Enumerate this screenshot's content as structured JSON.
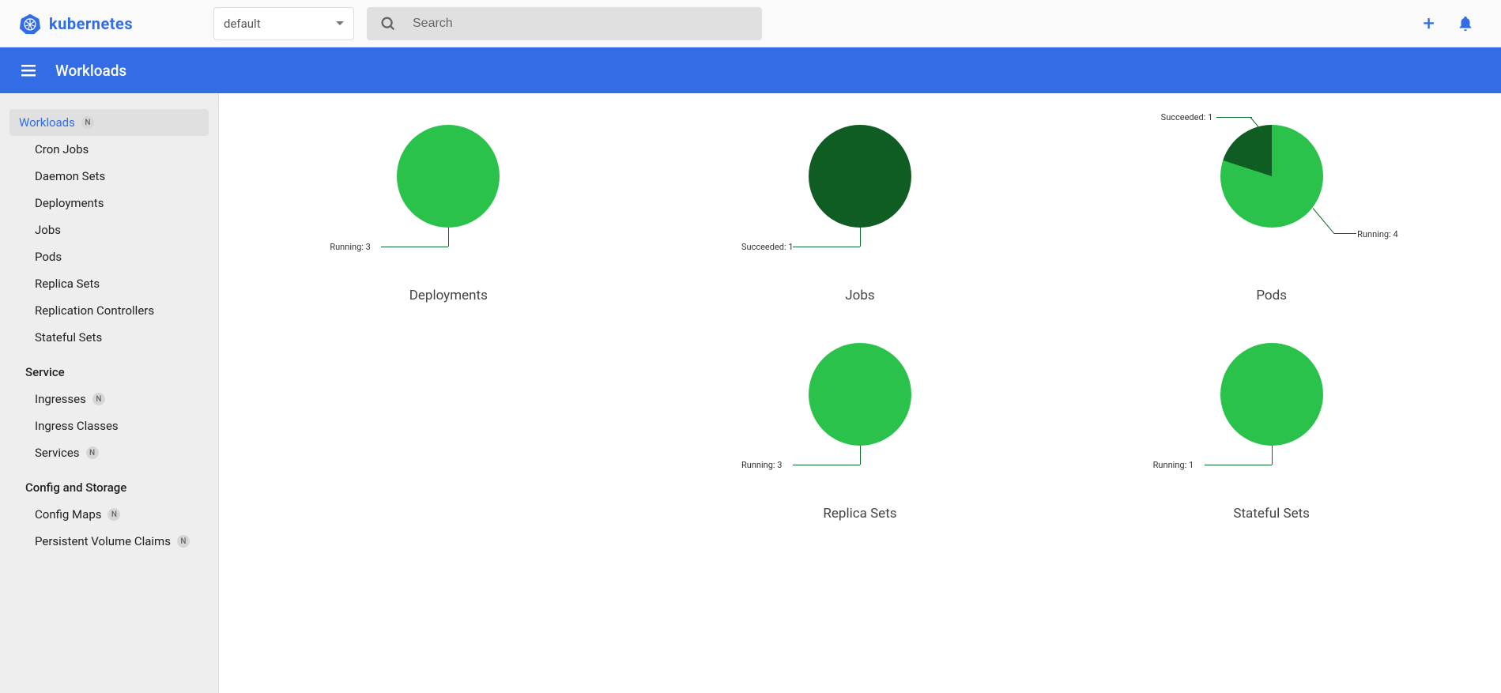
{
  "header": {
    "brand": "kubernetes",
    "namespace_selected": "default",
    "search_placeholder": "Search"
  },
  "subheader": {
    "title": "Workloads"
  },
  "sidebar": {
    "workloads_label": "Workloads",
    "items_workloads": [
      "Cron Jobs",
      "Daemon Sets",
      "Deployments",
      "Jobs",
      "Pods",
      "Replica Sets",
      "Replication Controllers",
      "Stateful Sets"
    ],
    "service_header": "Service",
    "items_service": [
      "Ingresses",
      "Ingress Classes",
      "Services"
    ],
    "service_badges": [
      true,
      false,
      true
    ],
    "config_header": "Config and Storage",
    "items_config": [
      "Config Maps",
      "Persistent Volume Claims"
    ],
    "config_badges": [
      true,
      true
    ]
  },
  "chart_data": [
    {
      "type": "pie",
      "title": "Deployments",
      "series": [
        {
          "name": "Running",
          "value": 3,
          "color": "#2ac24a"
        }
      ],
      "labels": [
        {
          "text": "Running: 3",
          "pos": "bl"
        }
      ]
    },
    {
      "type": "pie",
      "title": "Jobs",
      "series": [
        {
          "name": "Succeeded",
          "value": 1,
          "color": "#0f5d22"
        }
      ],
      "labels": [
        {
          "text": "Succeeded: 1",
          "pos": "bl"
        }
      ]
    },
    {
      "type": "pie",
      "title": "Pods",
      "series": [
        {
          "name": "Succeeded",
          "value": 1,
          "color": "#0f5d22"
        },
        {
          "name": "Running",
          "value": 4,
          "color": "#2ac24a"
        }
      ],
      "labels": [
        {
          "text": "Succeeded: 1",
          "pos": "tl"
        },
        {
          "text": "Running: 4",
          "pos": "br"
        }
      ]
    },
    {
      "type": "pie",
      "title": "Replica Sets",
      "series": [
        {
          "name": "Running",
          "value": 3,
          "color": "#2ac24a"
        }
      ],
      "labels": [
        {
          "text": "Running: 3",
          "pos": "bl"
        }
      ]
    },
    {
      "type": "pie",
      "title": "Stateful Sets",
      "series": [
        {
          "name": "Running",
          "value": 1,
          "color": "#2ac24a"
        }
      ],
      "labels": [
        {
          "text": "Running: 1",
          "pos": "bl"
        }
      ]
    }
  ]
}
